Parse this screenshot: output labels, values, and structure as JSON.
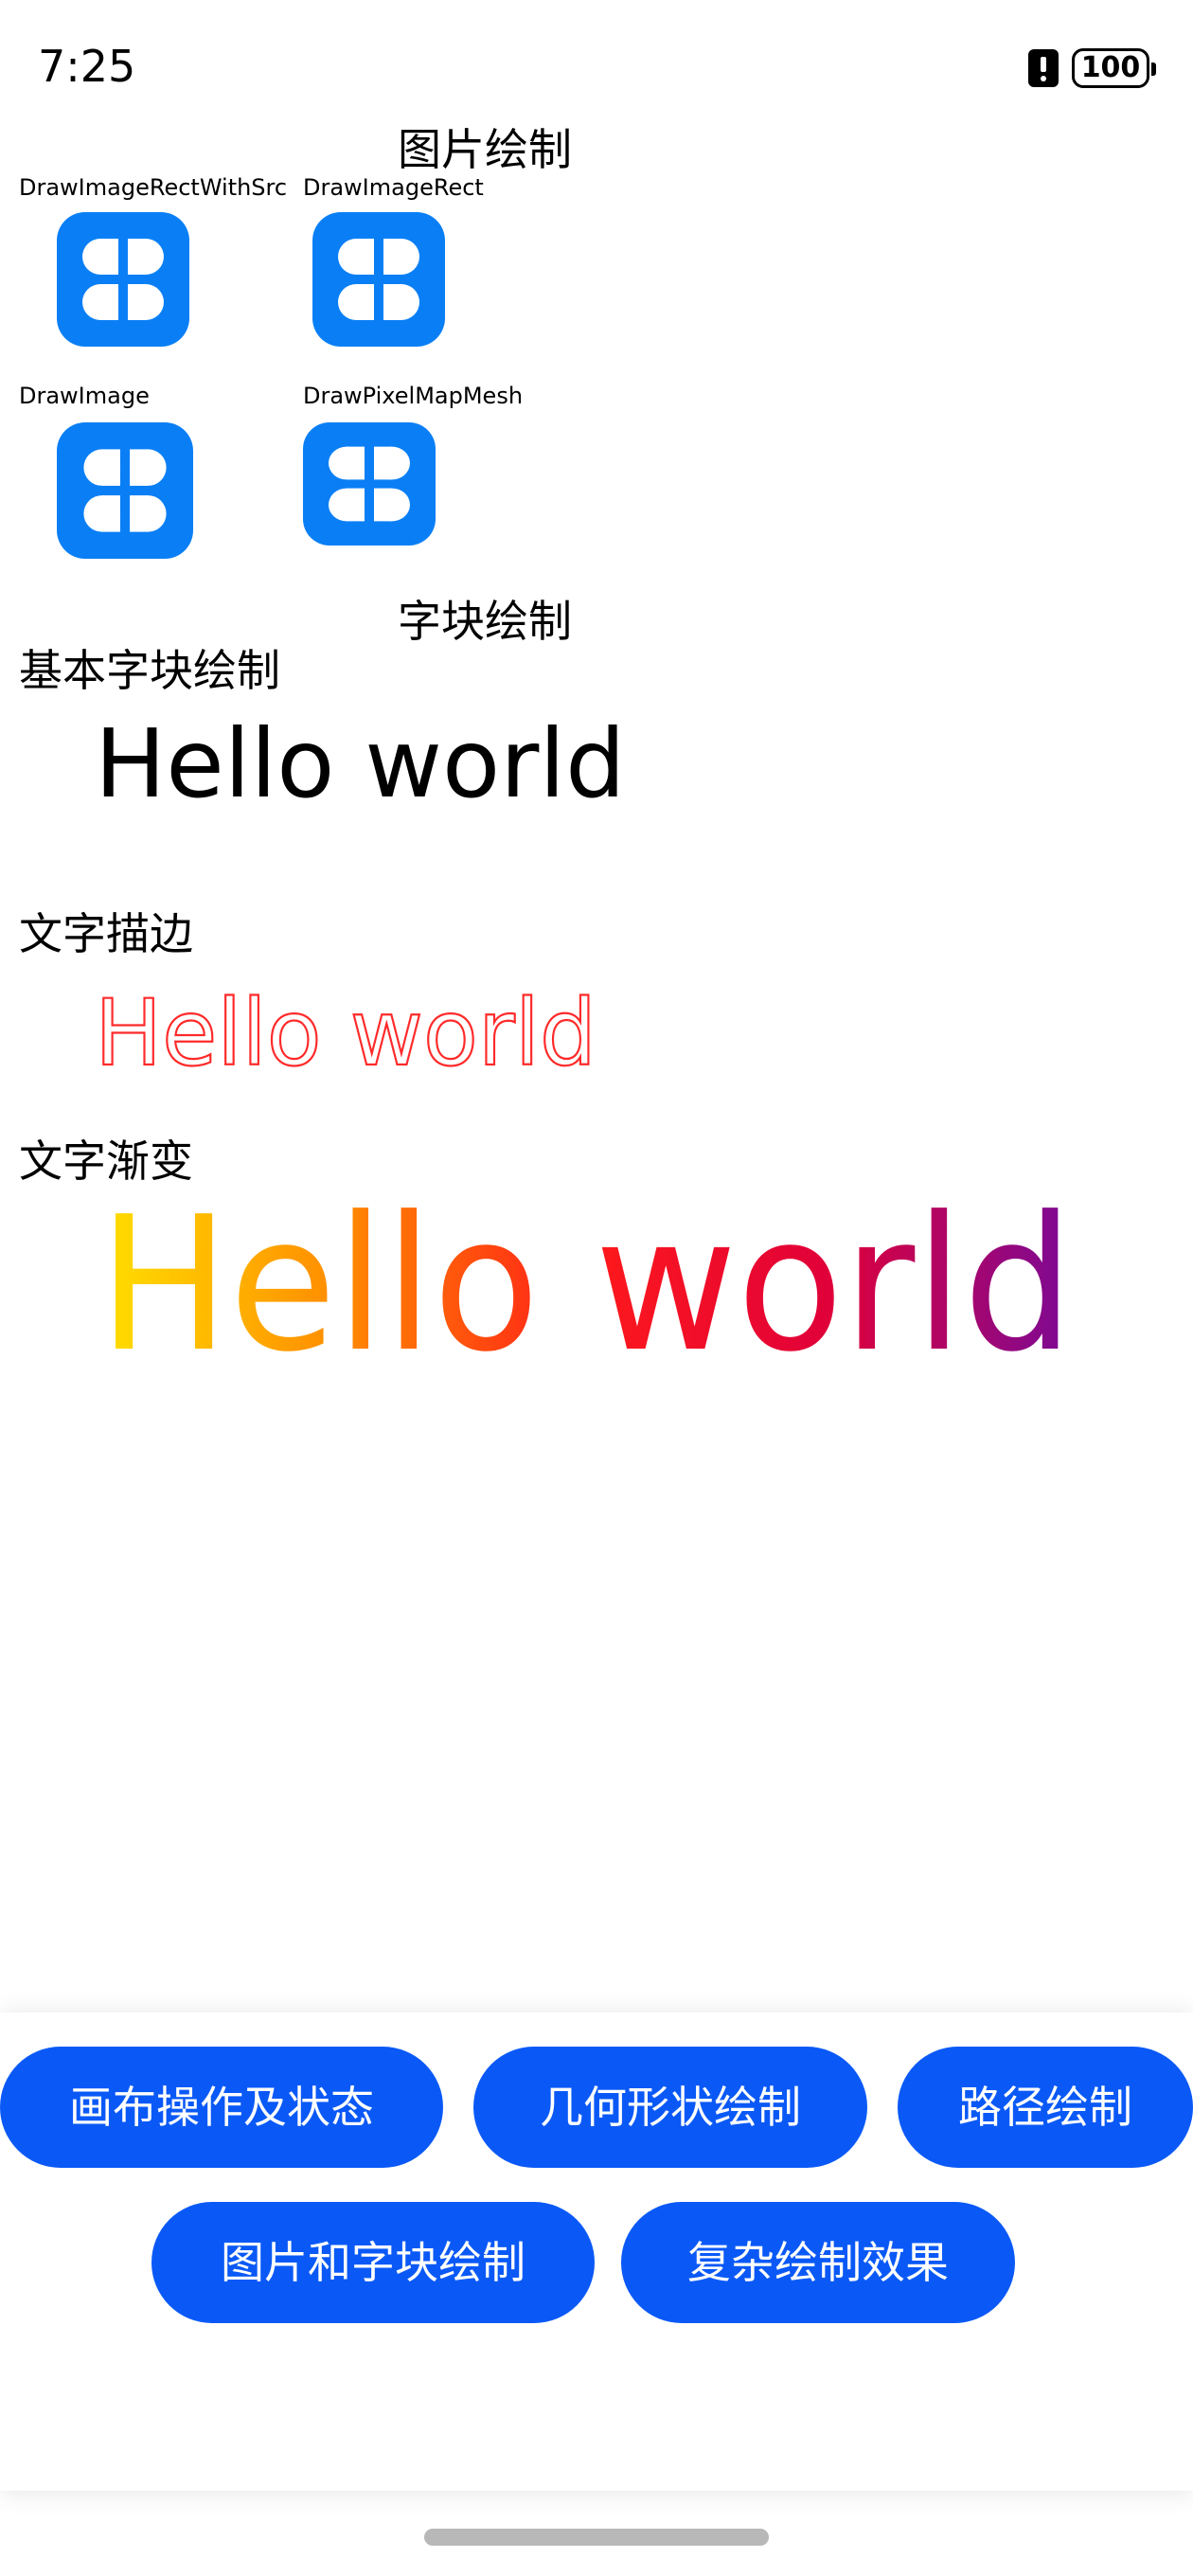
{
  "status_bar": {
    "time": "7:25",
    "battery": "100",
    "alert_icon": "alert-icon"
  },
  "image_section": {
    "heading": "图片绘制",
    "items": [
      {
        "label": "DrawImageRectWithSrc",
        "icon": "app-grid-icon"
      },
      {
        "label": "DrawImageRect",
        "icon": "app-grid-icon"
      },
      {
        "label": "DrawImage",
        "icon": "app-grid-icon"
      },
      {
        "label": "DrawPixelMapMesh",
        "icon": "app-grid-icon"
      }
    ],
    "icon_color": "#0a7ff5"
  },
  "text_section": {
    "heading": "字块绘制",
    "basic": {
      "label": "基本字块绘制",
      "text": "Hello world",
      "color": "#000000"
    },
    "stroke": {
      "label": "文字描边",
      "text": "Hello world",
      "color": "#ff2a2a"
    },
    "gradient": {
      "label": "文字渐变",
      "text": "Hello world",
      "colors": [
        "#ffe000",
        "#ff7a00",
        "#ff1a1a",
        "#e0003a",
        "#7a0a96"
      ]
    }
  },
  "nav_buttons": [
    {
      "label": "画布操作及状态"
    },
    {
      "label": "几何形状绘制"
    },
    {
      "label": "路径绘制"
    },
    {
      "label": "图片和字块绘制"
    },
    {
      "label": "复杂绘制效果"
    }
  ],
  "theme": {
    "button_color": "#0a59f7",
    "button_text_color": "#ffffff"
  }
}
